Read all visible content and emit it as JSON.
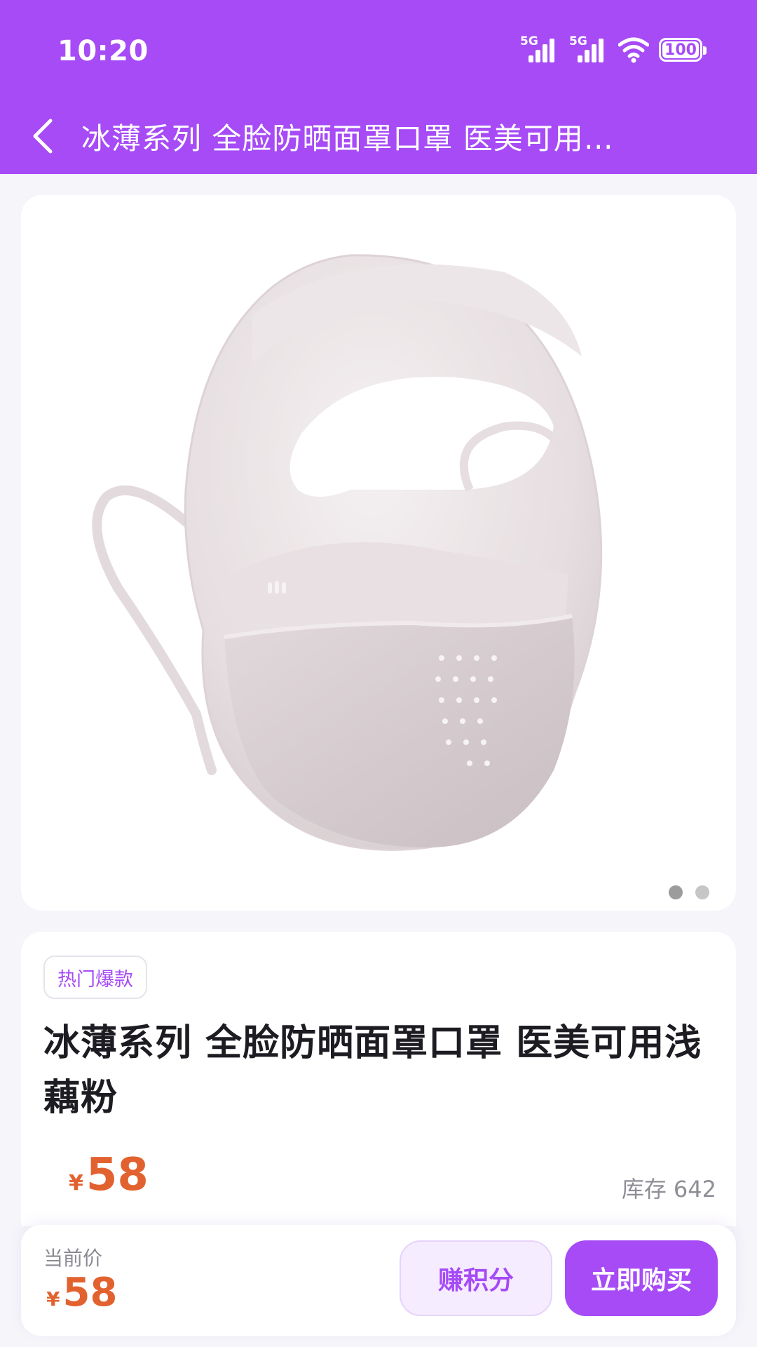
{
  "status_bar": {
    "time": "10:20",
    "network_1": "5G",
    "network_2": "5G",
    "battery": "100"
  },
  "nav": {
    "title": "冰薄系列 全脸防晒面罩口罩 医美可用…"
  },
  "gallery": {
    "image_label": "face-mask-product-image",
    "slide_count": 2,
    "active_index": 0
  },
  "product": {
    "tag": "热门爆款",
    "title": "冰薄系列 全脸防晒面罩口罩 医美可用浅藕粉",
    "price_symbol": "¥",
    "price": "58",
    "stock_label": "库存",
    "stock_value": "642"
  },
  "bottom_bar": {
    "current_price_label": "当前价",
    "price_symbol": "¥",
    "price": "58",
    "earn_points_label": "赚积分",
    "buy_now_label": "立即购买"
  },
  "colors": {
    "brand": "#a64bf6",
    "price": "#e2622f",
    "background": "#f5f5fa"
  }
}
